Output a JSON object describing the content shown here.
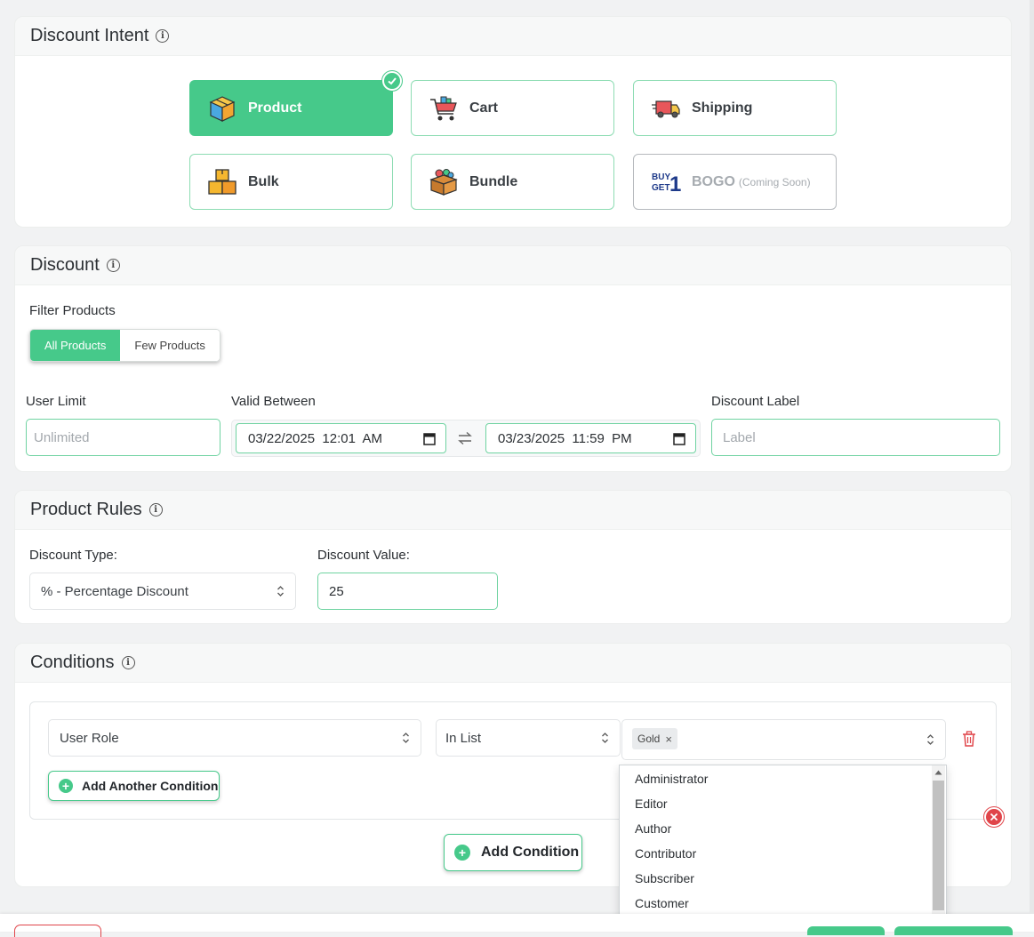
{
  "discount_intent": {
    "title": "Discount Intent",
    "tiles": [
      {
        "label": "Product",
        "icon": "product-box-icon",
        "state": "selected"
      },
      {
        "label": "Cart",
        "icon": "shopping-cart-icon",
        "state": "normal"
      },
      {
        "label": "Shipping",
        "icon": "delivery-truck-icon",
        "state": "normal"
      },
      {
        "label": "Bulk",
        "icon": "stacked-boxes-icon",
        "state": "normal"
      },
      {
        "label": "Bundle",
        "icon": "bundle-box-icon",
        "state": "normal"
      },
      {
        "label": "BOGO",
        "note": "(Coming Soon)",
        "icon": "buy1-get1-icon",
        "state": "disabled"
      }
    ]
  },
  "discount": {
    "title": "Discount",
    "filter_label": "Filter Products",
    "filter_options": [
      "All Products",
      "Few Products"
    ],
    "filter_selected": "All Products",
    "user_limit_label": "User Limit",
    "user_limit_placeholder": "Unlimited",
    "valid_between_label": "Valid Between",
    "valid_from": "03/22/2025  12:01  AM",
    "valid_to": "03/23/2025  11:59  PM",
    "label_label": "Discount Label",
    "label_placeholder": "Label"
  },
  "product_rules": {
    "title": "Product Rules",
    "type_label": "Discount Type:",
    "type_value": "% - Percentage Discount",
    "value_label": "Discount Value:",
    "value": "25"
  },
  "conditions": {
    "title": "Conditions",
    "field_value": "User Role",
    "operator_value": "In List",
    "selected_tags": [
      "Gold"
    ],
    "add_another_label": "Add Another Condition",
    "add_condition_label": "Add Condition",
    "dropdown_options": [
      "Administrator",
      "Editor",
      "Author",
      "Contributor",
      "Subscriber",
      "Customer"
    ]
  },
  "colors": {
    "accent": "#46c98a",
    "danger": "#e0454a"
  }
}
